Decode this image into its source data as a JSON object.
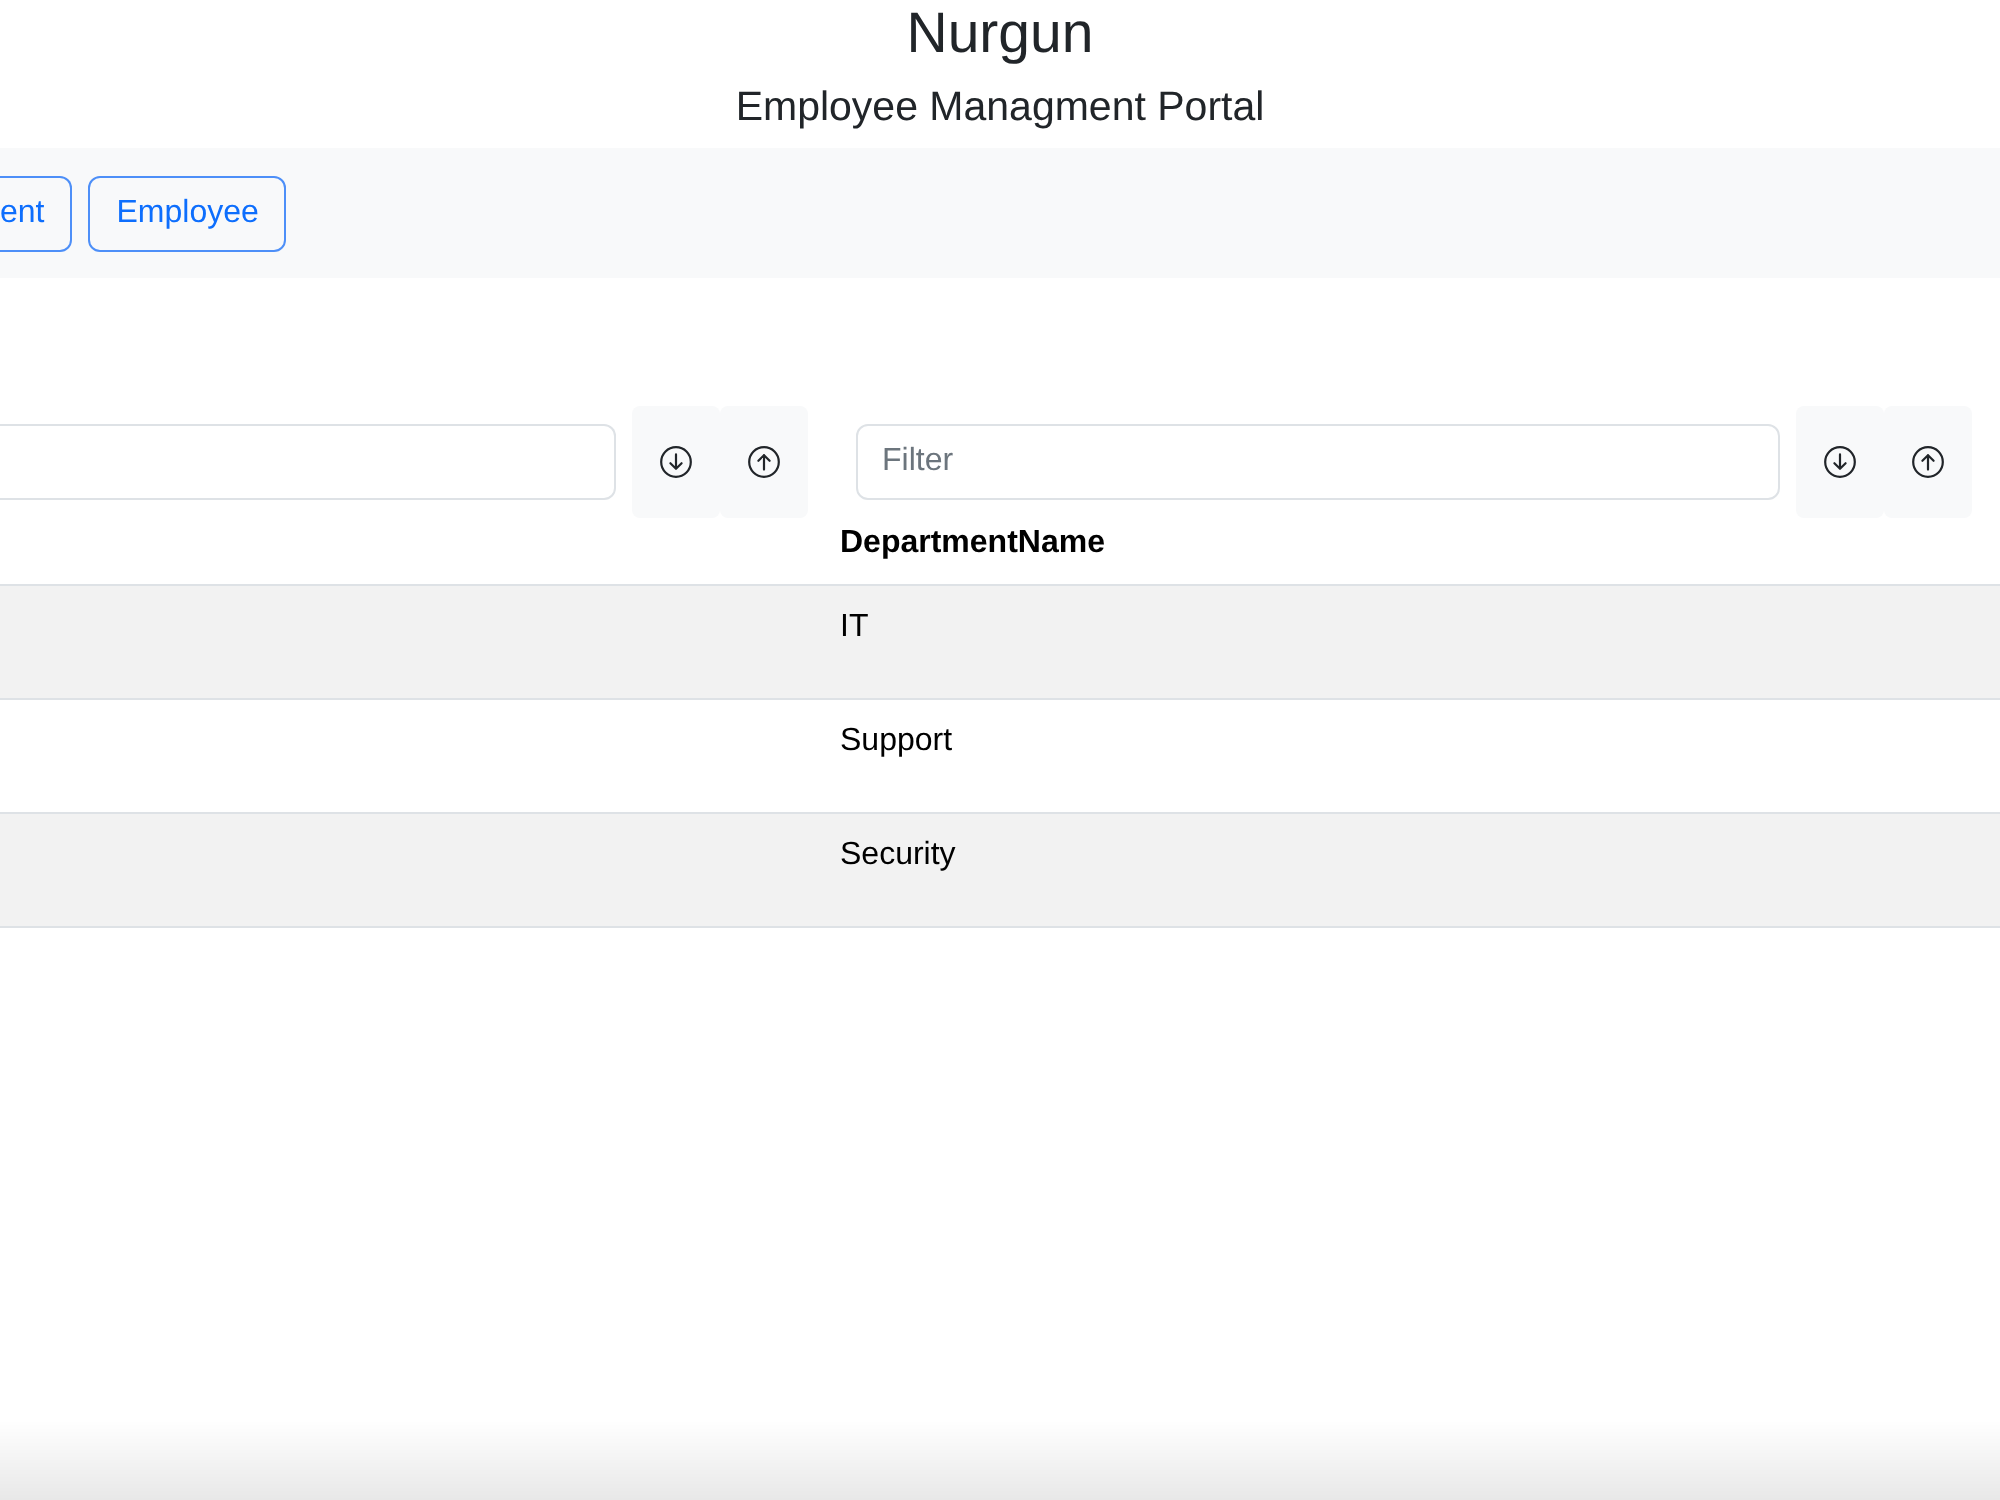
{
  "header": {
    "title": "Nurgun",
    "subtitle": "Employee Managment Portal"
  },
  "nav": {
    "buttons": [
      {
        "label": "ent",
        "kind": "clipped"
      },
      {
        "label": "Employee",
        "kind": "full"
      }
    ]
  },
  "table": {
    "columns": [
      {
        "kind": "clipped"
      },
      {
        "kind": "full",
        "header": "DepartmentName",
        "filter": {
          "placeholder": "Filter"
        }
      }
    ],
    "rows": [
      {
        "department_name": "IT"
      },
      {
        "department_name": "Support"
      },
      {
        "department_name": "Security"
      }
    ]
  }
}
